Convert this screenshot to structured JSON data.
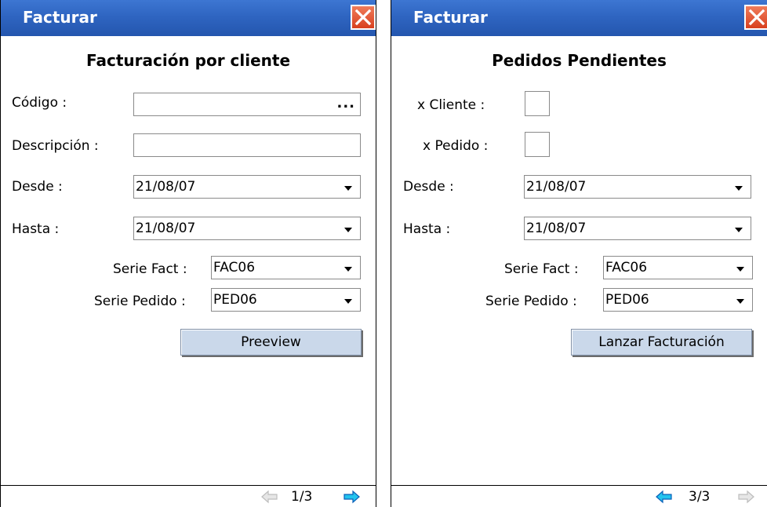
{
  "colors": {
    "titlebar": "#2f65c1",
    "close": "#e0522f",
    "button": "#cad8ea",
    "arrow_active": "#1ab7e8",
    "arrow_active_dark": "#0e4db3",
    "arrow_disabled": "#c8c8c8"
  },
  "panel1": {
    "window_title": "Facturar",
    "heading": "Facturación por cliente",
    "codigo_label": "Código :",
    "codigo_value": "",
    "codigo_browse": "...",
    "descripcion_label": "Descripción :",
    "descripcion_value": "",
    "desde_label": "Desde :",
    "desde_value": "21/08/07",
    "hasta_label": "Hasta :",
    "hasta_value": "21/08/07",
    "serie_fact_label": "Serie Fact :",
    "serie_fact_value": "FAC06",
    "serie_pedido_label": "Serie Pedido :",
    "serie_pedido_value": "PED06",
    "button_label": "Preeview",
    "page_indicator": "1/3",
    "prev_icon": "arrow-left-icon",
    "next_icon": "arrow-right-icon"
  },
  "panel2": {
    "window_title": "Facturar",
    "heading": "Pedidos Pendientes",
    "x_cliente_label": "x Cliente :",
    "x_pedido_label": "x Pedido :",
    "desde_label": "Desde :",
    "desde_value": "21/08/07",
    "hasta_label": "Hasta :",
    "hasta_value": "21/08/07",
    "serie_fact_label": "Serie Fact :",
    "serie_fact_value": "FAC06",
    "serie_pedido_label": "Serie Pedido :",
    "serie_pedido_value": "PED06",
    "button_label": "Lanzar Facturación",
    "page_indicator": "3/3",
    "prev_icon": "arrow-left-icon",
    "next_icon": "arrow-right-icon"
  }
}
